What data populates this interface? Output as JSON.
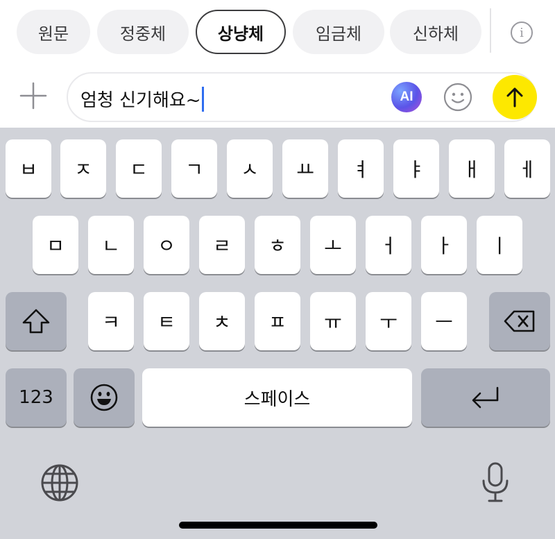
{
  "style_tabs": [
    {
      "label": "원문",
      "active": false
    },
    {
      "label": "정중체",
      "active": false
    },
    {
      "label": "상냥체",
      "active": true
    },
    {
      "label": "임금체",
      "active": false
    },
    {
      "label": "신하체",
      "active": false
    }
  ],
  "info_icon": "info-icon",
  "composer": {
    "text": "엄청 신기해요~",
    "ai_label": "AI",
    "send_color": "#fde800"
  },
  "keyboard": {
    "row1": [
      "ㅂ",
      "ㅈ",
      "ㄷ",
      "ㄱ",
      "ㅅ",
      "ㅛ",
      "ㅕ",
      "ㅑ",
      "ㅐ",
      "ㅔ"
    ],
    "row2": [
      "ㅁ",
      "ㄴ",
      "ㅇ",
      "ㄹ",
      "ㅎ",
      "ㅗ",
      "ㅓ",
      "ㅏ",
      "ㅣ"
    ],
    "row3": [
      "ㅋ",
      "ㅌ",
      "ㅊ",
      "ㅍ",
      "ㅠ",
      "ㅜ",
      "ㅡ"
    ],
    "numbers_label": "123",
    "space_label": "스페이스"
  }
}
